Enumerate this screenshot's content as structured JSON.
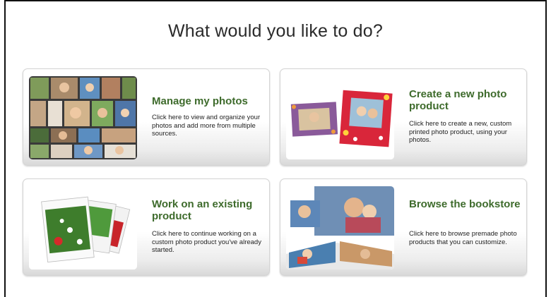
{
  "page": {
    "title": "What would you like to do?"
  },
  "cards": [
    {
      "title": "Manage my photos",
      "description": "Click here to view and organize your photos and add more from multiple sources.",
      "image": "photo-collage"
    },
    {
      "title": "Create a new photo product",
      "description": "Click here to create a new, custom printed photo product, using your photos.",
      "image": "photo-frames"
    },
    {
      "title": "Work on an existing product",
      "description": "Click here to continue working on a custom photo product you've already started.",
      "image": "photo-cards-stack"
    },
    {
      "title": "Browse the bookstore",
      "description": "Click here to browse premade photo products that you can customize.",
      "image": "photo-books"
    }
  ],
  "colors": {
    "title_text": "#2a2a2a",
    "card_title": "#3e6b2c",
    "card_border": "#d4d4d4"
  }
}
